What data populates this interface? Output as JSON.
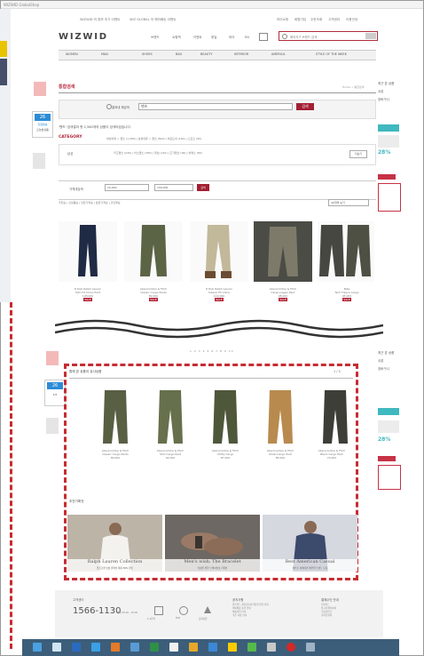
{
  "window": {
    "title": "WIZWID GlobalShop"
  },
  "topnav": {
    "items": [
      "WIZWID 의 정보 추가 이벤트",
      "WIZ GLOBAL 의 해외배송 이벤트",
      "마이쇼핑",
      "회원가입",
      "주문조회",
      "고객센터",
      "이용안내"
    ]
  },
  "header": {
    "logo": "WIZWID",
    "menu": [
      "브랜드",
      "쇼핑백",
      "이벤트",
      "핫딜",
      "마이",
      "EN"
    ],
    "search_placeholder": "해외직구 브랜드 검색"
  },
  "category_bar": [
    "WOMEN",
    "MAN",
    "SHOES",
    "BAG",
    "BEAUTY",
    "INTERIOR",
    "AMERICA",
    "STYLE OF THE WEEK"
  ],
  "left_widgets": {
    "today_label": "오늘본상품",
    "badge_text": "26",
    "badge_sub": "당일발송",
    "count": "1/5"
  },
  "right_side": {
    "items": [
      "최근 본 상품",
      "쿠폰",
      "장바구니"
    ],
    "pct": "28%",
    "more": "더보기"
  },
  "page": {
    "title": "통합검색",
    "breadcrumb": "Home > 통합검색"
  },
  "search": {
    "radio": "결과내 재검색",
    "query": "팬츠",
    "button": "검색",
    "result_text": "'팬츠' 검색결과 총 2,560개의 상품이 검색되었습니다.",
    "category_label": "CATEGORY",
    "cat_row1": "여성의류 > 팬츠 (1,280) | 남성의류 > 팬츠 (820) | 아웃도어 (160) | 스포츠 (90)",
    "cat_row2_label": "남성",
    "cat_row2": "카고팬츠 (240) | 치노팬츠 (180) | 데님 (120) | 조거팬츠 (96) | 슬랙스 (80)",
    "more_btn": "더보기"
  },
  "filter": {
    "label": "가격대검색",
    "min": "10,000",
    "max": "100,000",
    "button": "검색",
    "sort": "추천순 | 신상품순 | 낮은가격순 | 높은가격순 | 할인율순",
    "view": "40개씩 보기"
  },
  "products": [
    {
      "brand": "R Polo Ralph Lauren",
      "name": "Slim Fit Chino Pant",
      "price": "128,000",
      "badge": "SALE"
    },
    {
      "brand": "Abercrombie & Fitch",
      "name": "Classic Cargo Pants",
      "price": "89,000",
      "badge": "SALE"
    },
    {
      "brand": "R Polo Ralph Lauren",
      "name": "Classic Fit Chino",
      "price": "119,000",
      "badge": "SALE"
    },
    {
      "brand": "Abercrombie & Fitch",
      "name": "Cargo Jogger Pant",
      "price": "98,000",
      "badge": "SALE"
    },
    {
      "brand": "Nike",
      "name": "Tech Fleece Cargo",
      "price": "95,000",
      "badge": "SALE"
    }
  ],
  "pagination": "1 2 3 4 5 6 7 8 9 10",
  "recommend": {
    "title": "함께 본 상품이 유사상품",
    "nav": "1 / 3",
    "items": [
      {
        "brand": "Abercrombie & Fitch",
        "name": "Classic Cargo Pants",
        "price": "89,000"
      },
      {
        "brand": "Abercrombie & Fitch",
        "name": "Slim Cargo Pant",
        "price": "92,000"
      },
      {
        "brand": "Abercrombie & Fitch",
        "name": "Utility Cargo",
        "price": "87,000"
      },
      {
        "brand": "Abercrombie & Fitch",
        "name": "Khaki Cargo Pant",
        "price": "85,000"
      },
      {
        "brand": "Abercrombie & Fitch",
        "name": "Black Cargo Pant",
        "price": "79,000"
      }
    ]
  },
  "picks": {
    "title": "추천기획전",
    "banners": [
      {
        "title": "Ralph Lauren Collection",
        "sub": "랄프로렌 남성 컬렉션 최대 30% 할인"
      },
      {
        "title": "Men's wish: The Bracelet",
        "sub": "남성을 위한 브레이슬릿 기획전"
      },
      {
        "title": "Best American Casual",
        "sub": "베스트 아메리칸 캐주얼 브랜드 모음"
      }
    ]
  },
  "footer": {
    "cs_label": "고객센터",
    "phone": "1566-1130",
    "hours": "평일 09:00 - 18:00",
    "icons": [
      "1:1문의",
      "FAQ",
      "공지사항"
    ],
    "notice_title": "공지사항",
    "notice": [
      "위즈위드 개인정보처리방침 변경 안내",
      "해외배송 통관 안내",
      "배송지연 안내",
      "쿠폰 사용 안내"
    ],
    "pay_title": "결제수단 안내",
    "pay": [
      "신용카드",
      "실시간계좌이체",
      "무통장입금",
      "휴대폰결제"
    ]
  },
  "colors": {
    "accent": "#a31f33",
    "dashed": "#c62c32",
    "taskbar": "#3c5e7a"
  }
}
